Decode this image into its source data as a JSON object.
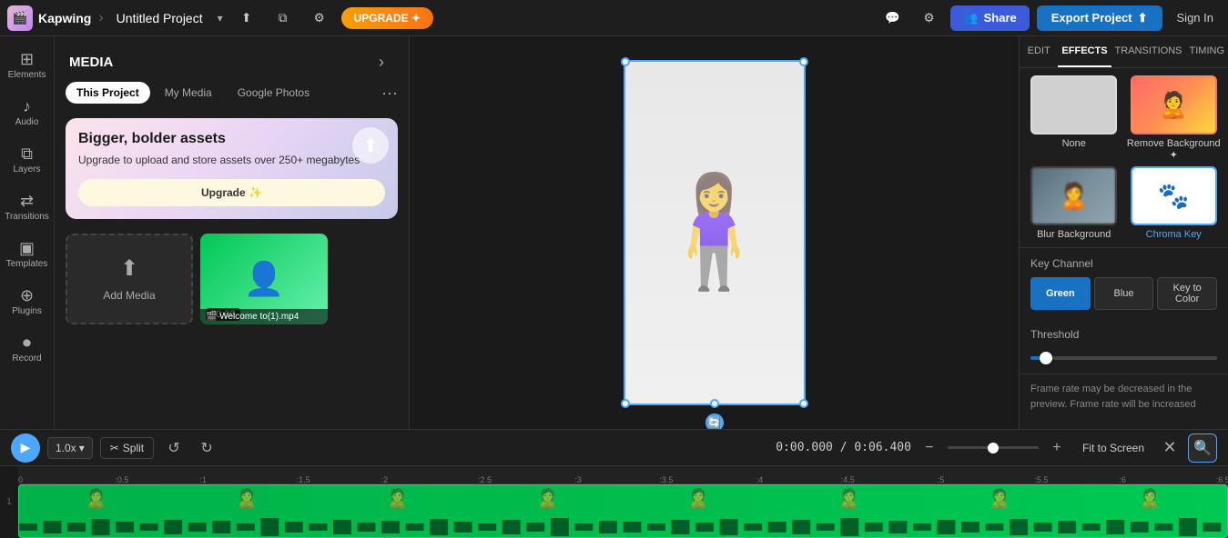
{
  "app": {
    "logo_text": "Kapwing",
    "project_name": "Untitled Project",
    "upgrade_label": "UPGRADE ✦",
    "export_label": "Export Project",
    "share_label": "Share",
    "signin_label": "Sign In"
  },
  "left_sidebar": {
    "items": [
      {
        "id": "elements",
        "label": "Elements",
        "icon": "⊞"
      },
      {
        "id": "audio",
        "label": "Audio",
        "icon": "♪"
      },
      {
        "id": "layers",
        "label": "Layers",
        "icon": "⧉"
      },
      {
        "id": "transitions",
        "label": "Transitions",
        "icon": "⇄"
      },
      {
        "id": "templates",
        "label": "Templates",
        "icon": "▣"
      },
      {
        "id": "plugins",
        "label": "Plugins",
        "icon": "⊕"
      },
      {
        "id": "record",
        "label": "Record",
        "icon": "⏺"
      }
    ]
  },
  "media_panel": {
    "title": "MEDIA",
    "tabs": [
      {
        "id": "this-project",
        "label": "This Project",
        "active": true
      },
      {
        "id": "my-media",
        "label": "My Media",
        "active": false
      },
      {
        "id": "google-photos",
        "label": "Google Photos",
        "active": false
      }
    ],
    "upgrade_banner": {
      "title": "Bigger, bolder assets",
      "description": "Upgrade to upload and store assets over 250+ megabytes",
      "button_label": "Upgrade ✨"
    },
    "add_media_label": "Add Media",
    "media_files": [
      {
        "filename": "Welcome to(1).mp4",
        "duration": "00:06"
      }
    ]
  },
  "canvas": {
    "time_display": "0:00.000 / 0:06.400"
  },
  "right_panel": {
    "tabs": [
      {
        "id": "edit",
        "label": "EDIT"
      },
      {
        "id": "effects",
        "label": "EFFECTS",
        "active": true
      },
      {
        "id": "transitions",
        "label": "TRANSITIONS"
      },
      {
        "id": "timing",
        "label": "TIMING"
      }
    ],
    "effects": [
      {
        "id": "none",
        "label": "None",
        "active": false
      },
      {
        "id": "remove-background",
        "label": "Remove Background",
        "active": false,
        "has_star": true
      },
      {
        "id": "blur-background",
        "label": "Blur Background",
        "active": false
      },
      {
        "id": "chroma-key",
        "label": "Chroma Key",
        "active": true
      }
    ],
    "key_channel_label": "Key Channel",
    "key_channel_options": [
      {
        "id": "green",
        "label": "Green",
        "active": true
      },
      {
        "id": "blue",
        "label": "Blue",
        "active": false
      },
      {
        "id": "key-to-color",
        "label": "Key to Color",
        "active": false
      }
    ],
    "threshold_label": "Threshold",
    "threshold_value": 5,
    "warning_text": "Frame rate may be decreased in the preview. Frame rate will be increased"
  },
  "timeline": {
    "play_label": "▶",
    "speed_label": "1.0x",
    "split_label": "Split",
    "undo_label": "↺",
    "redo_label": "↻",
    "time_current": "0:00.000",
    "time_total": "0:06.400",
    "time_separator": " / ",
    "fit_screen_label": "Fit to Screen",
    "ruler_marks": [
      "0",
      ":0.5",
      ":1",
      ":1.5",
      ":2",
      ":2.5",
      ":3",
      ":3.5",
      ":4",
      ":4.5",
      ":5",
      ":5.5",
      ":6",
      ":6.5"
    ],
    "track_number": "1"
  }
}
